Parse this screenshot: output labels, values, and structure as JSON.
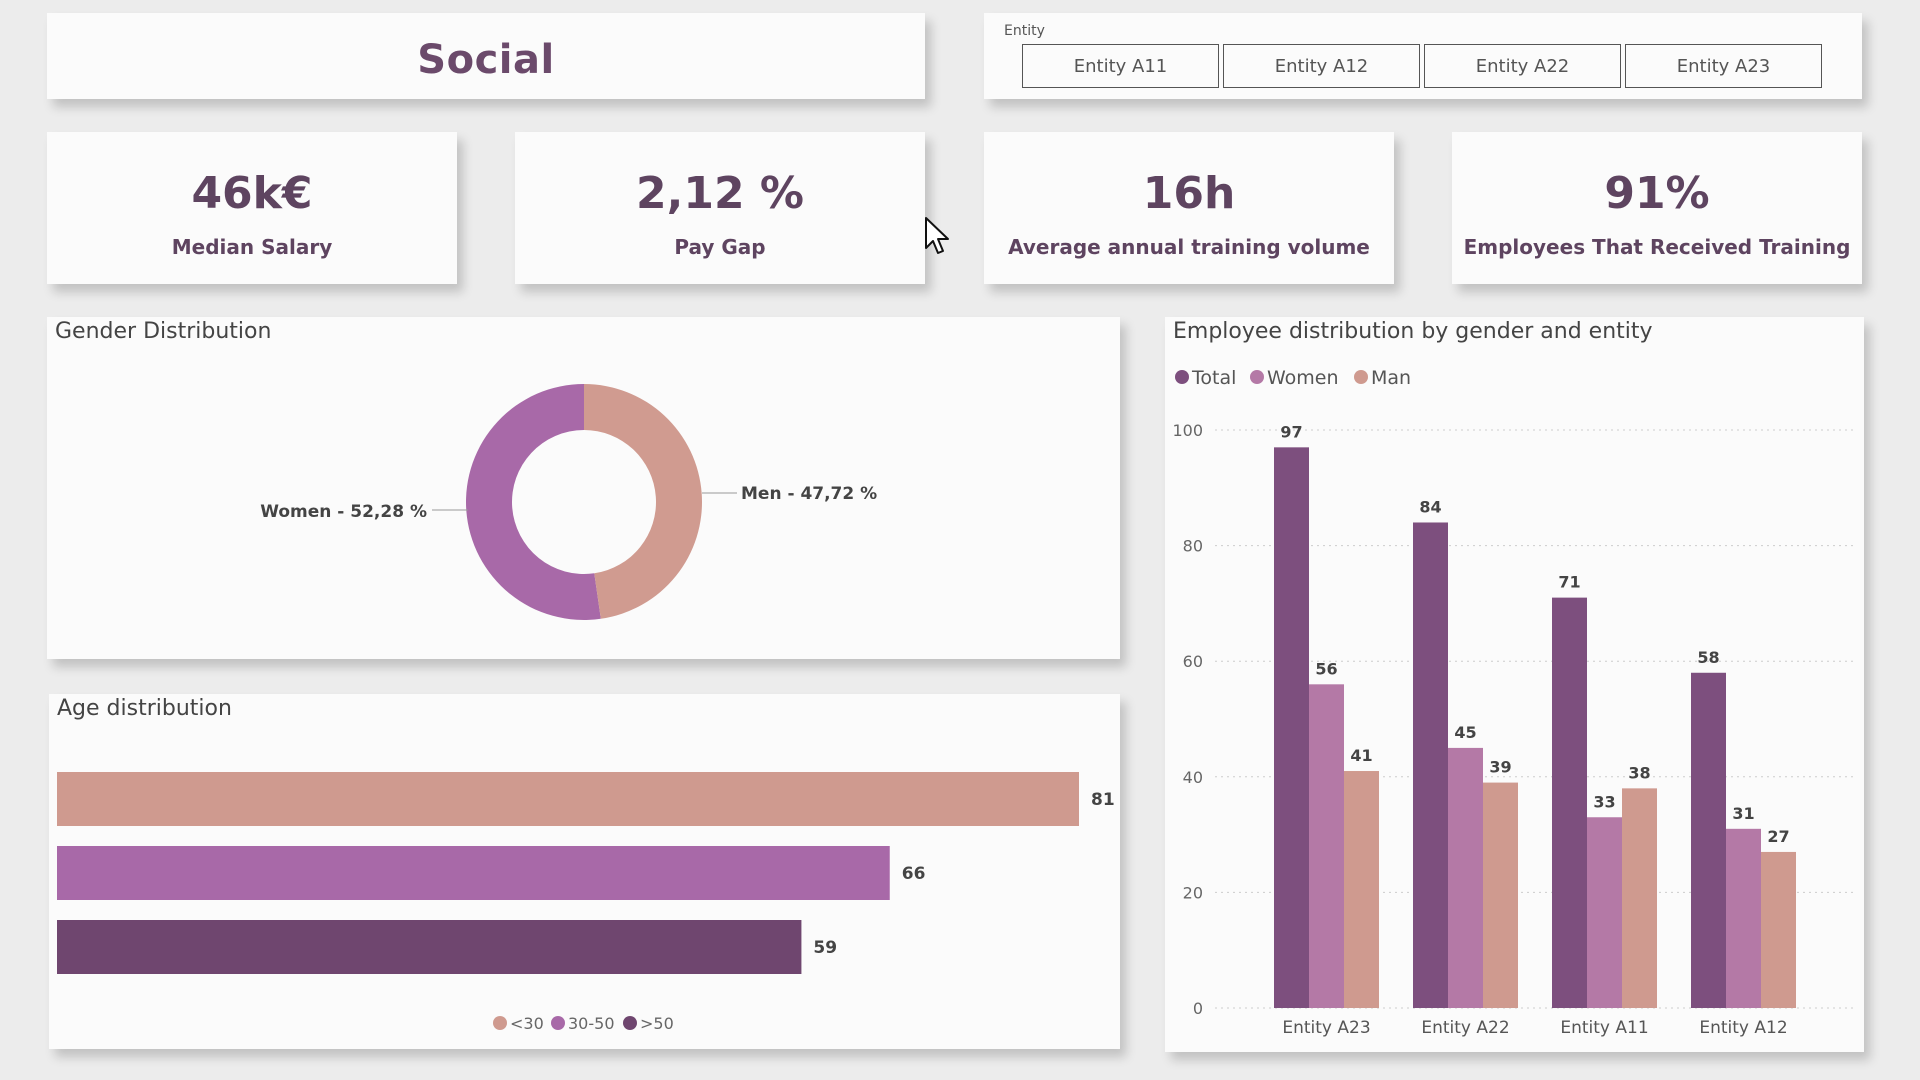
{
  "header": {
    "title": "Social"
  },
  "slicer": {
    "label": "Entity",
    "options": [
      "Entity A11",
      "Entity A12",
      "Entity A22",
      "Entity A23"
    ]
  },
  "kpis": [
    {
      "value": "46k€",
      "label": "Median Salary"
    },
    {
      "value": "2,12 %",
      "label": "Pay Gap"
    },
    {
      "value": "16h",
      "label": "Average annual training volume"
    },
    {
      "value": "91%",
      "label": "Employees That Received Training"
    }
  ],
  "gender": {
    "title": "Gender Distribution",
    "women_label": "Women - 52,28 %",
    "men_label": "Men - 47,72 %"
  },
  "age": {
    "title": "Age distribution",
    "legend": [
      "<30",
      "30-50",
      ">50"
    ]
  },
  "employees": {
    "title": "Employee distribution by gender and entity",
    "legend": [
      "Total",
      "Women",
      "Man"
    ]
  },
  "colors": {
    "total": "#7d4f7e",
    "women": "#b479a6",
    "man": "#cf9a8f",
    "women_donut": "#a869a8",
    "men_donut": "#d09b90",
    "age_lt30": "#cf9a8f",
    "age_30_50": "#a869a8",
    "age_gt50": "#6f466f",
    "kpi_text": "#5e4460"
  },
  "chart_data": [
    {
      "type": "pie",
      "donut": true,
      "labels": [
        "Women",
        "Men"
      ],
      "values": [
        52.28,
        47.72
      ]
    },
    {
      "type": "bar",
      "orientation": "horizontal",
      "categories": [
        "<30",
        "30-50",
        ">50"
      ],
      "values": [
        81,
        66,
        59
      ],
      "legend": "bottom-center"
    },
    {
      "type": "bar",
      "categories": [
        "Entity A23",
        "Entity A22",
        "Entity A11",
        "Entity A12"
      ],
      "series": [
        {
          "name": "Total",
          "values": [
            97,
            84,
            71,
            58
          ]
        },
        {
          "name": "Women",
          "values": [
            56,
            45,
            33,
            31
          ]
        },
        {
          "name": "Man",
          "values": [
            41,
            39,
            38,
            27
          ]
        }
      ],
      "yticks": [
        "0",
        "20",
        "40",
        "60",
        "80",
        "100"
      ],
      "ylim": [
        0,
        100
      ],
      "grid": true,
      "legend": "top-left"
    }
  ]
}
